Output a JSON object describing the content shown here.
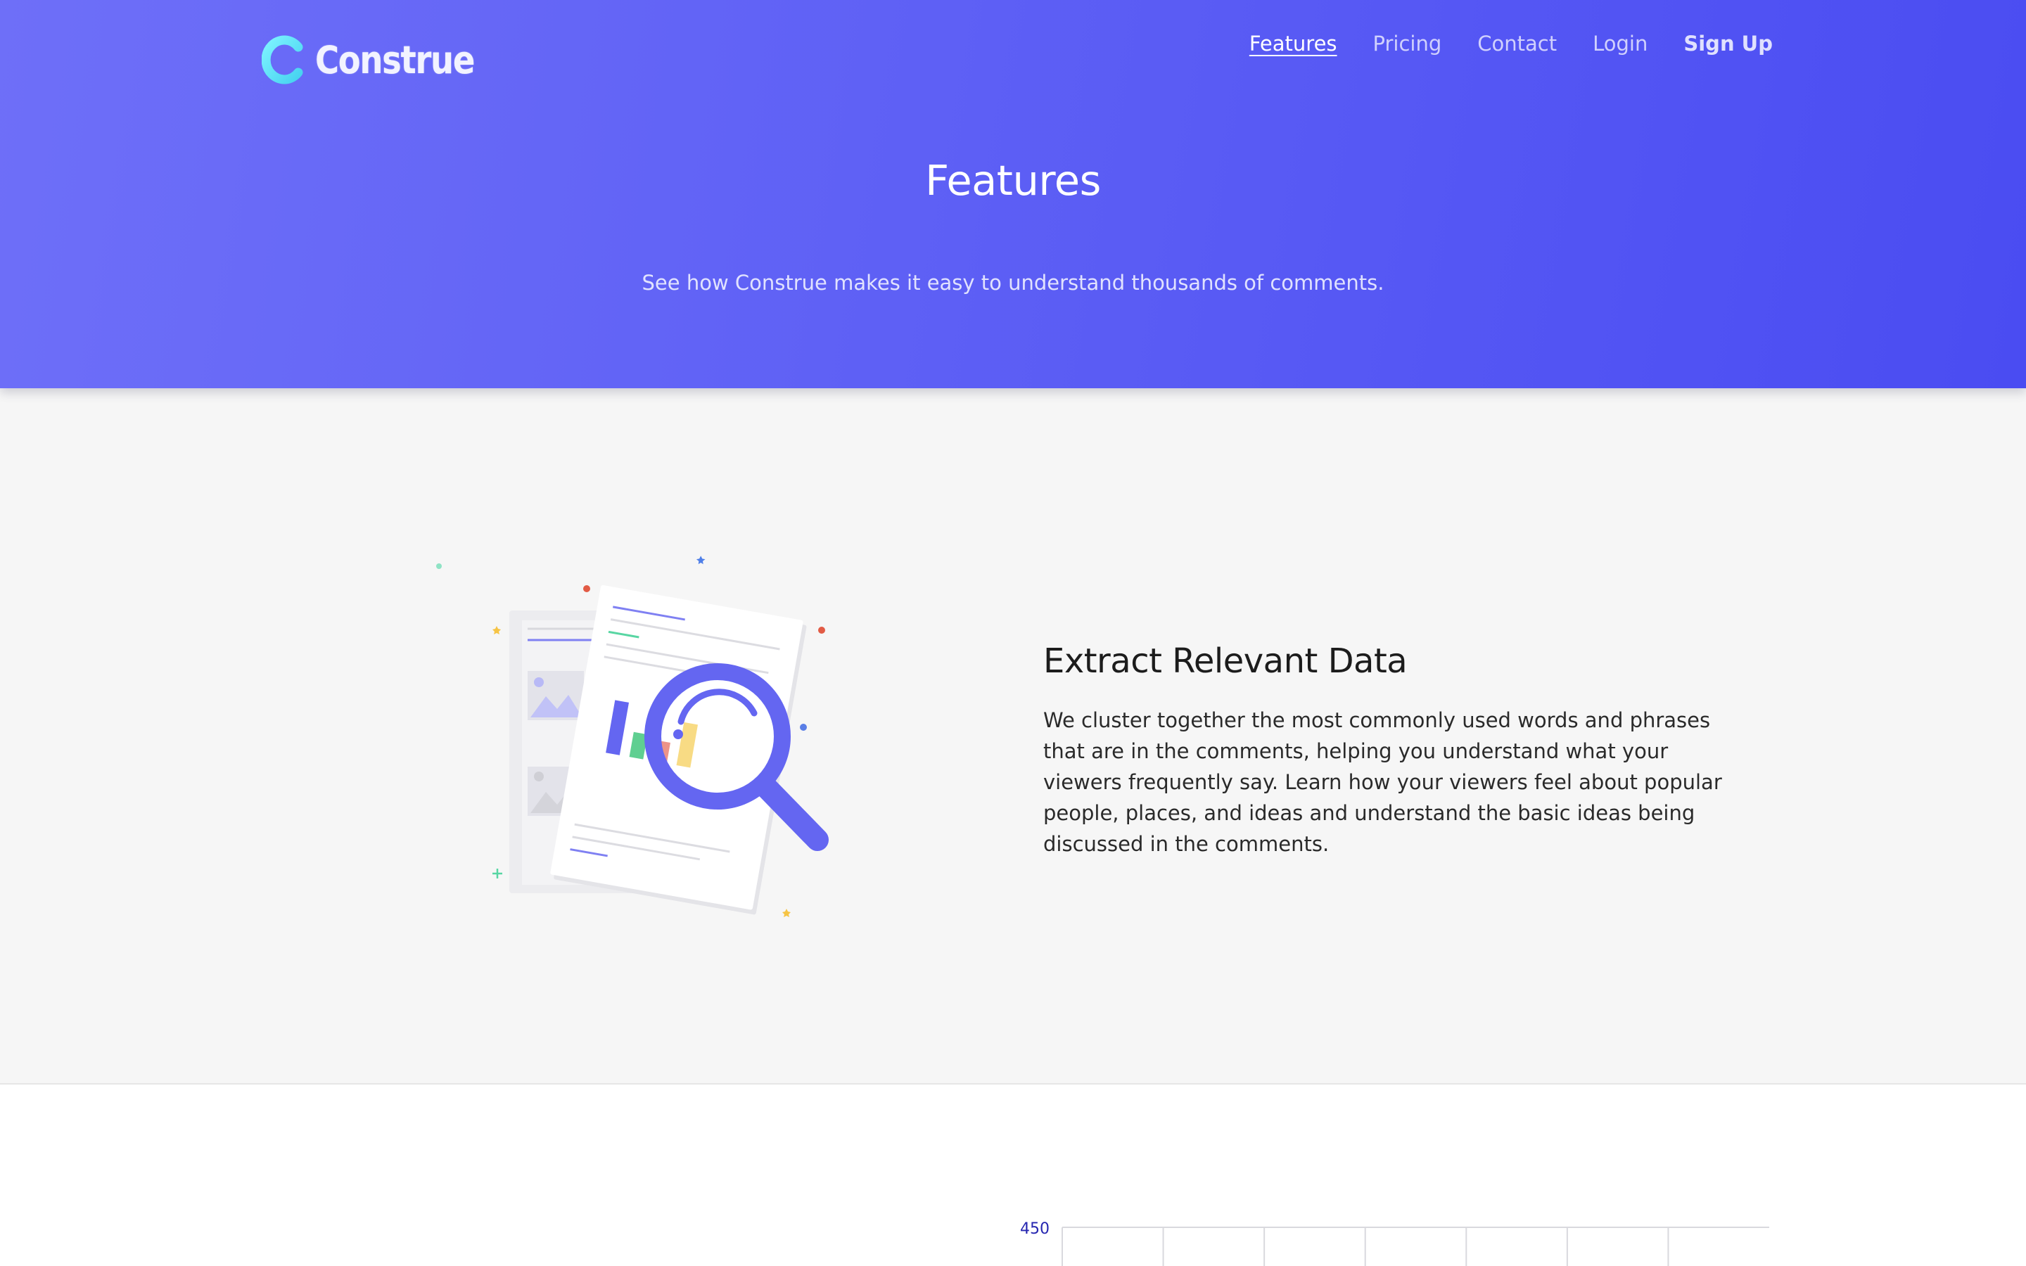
{
  "brand": {
    "logo_letter": "C",
    "name": "Construe"
  },
  "nav": {
    "items": [
      {
        "label": "Features",
        "active": true
      },
      {
        "label": "Pricing"
      },
      {
        "label": "Contact"
      },
      {
        "label": "Login"
      },
      {
        "label": "Sign Up",
        "emphasis": true
      }
    ]
  },
  "hero": {
    "title": "Features",
    "subtitle": "See how Construe makes it easy to understand thousands of comments."
  },
  "feature": {
    "illustration_icon": "document-magnifier-chart-illustration",
    "title": "Extract Relevant Data",
    "description": "We cluster together the most commonly used words and phrases that are in the comments, helping you understand what your viewers frequently say. Learn how your viewers feel about popular people, places, and ideas and understand the basic ideas being discussed in the comments."
  },
  "chart_data": {
    "type": "bar",
    "title": "",
    "xlabel": "",
    "ylabel": "",
    "visible_ticks": [
      "450"
    ],
    "ylim_top": 450,
    "grid": true,
    "vertical_gridlines": 7
  },
  "colors": {
    "hero_start": "#6e6ff8",
    "hero_end": "#4a4cf2",
    "accent": "#6366f1",
    "logo_mark": "#5ee7f4",
    "tick_label": "#2626b0"
  }
}
